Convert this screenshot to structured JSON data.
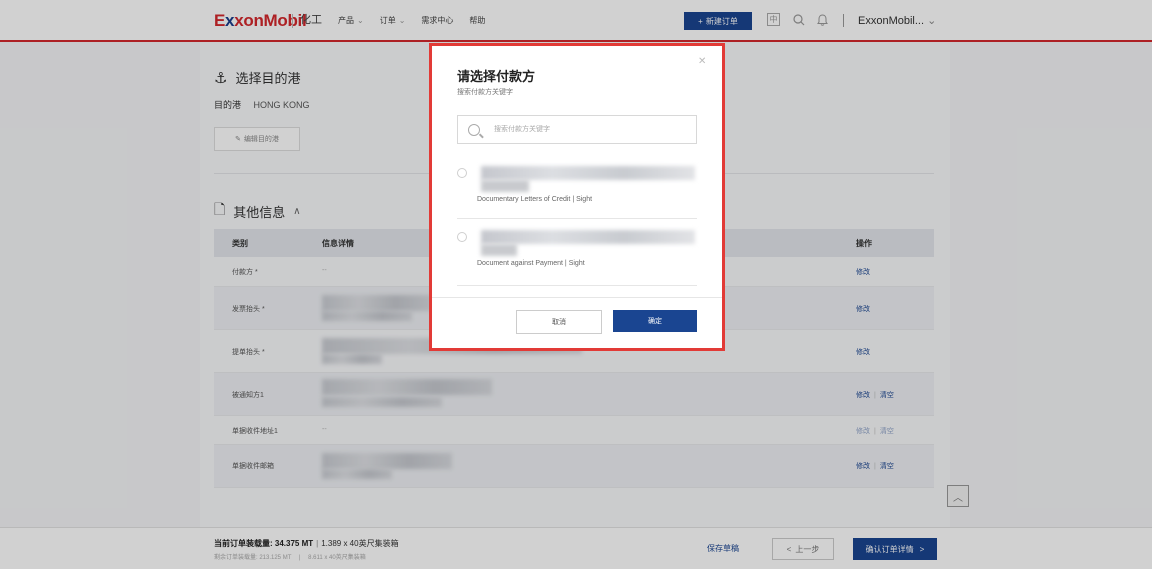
{
  "header": {
    "logo": "ExxonMobil",
    "nav": [
      "化工",
      "产品",
      "订单",
      "需求中心",
      "帮助"
    ],
    "new_order_label": "新建订单",
    "user_name": "ExxonMobil..."
  },
  "destination": {
    "title": "选择目的港",
    "port_label": "目的港",
    "port_value": "HONG KONG",
    "edit_button": "编辑目的港"
  },
  "other_info": {
    "title": "其他信息",
    "columns": {
      "category": "类别",
      "details": "信息详情",
      "action": "操作"
    },
    "rows": [
      {
        "label": "付款方 *",
        "detail": "--",
        "actions": [
          "修改"
        ]
      },
      {
        "label": "发票抬头 *",
        "detail": "",
        "actions": [
          "修改"
        ]
      },
      {
        "label": "提单抬头 *",
        "detail": "",
        "actions": [
          "修改"
        ]
      },
      {
        "label": "被通知方1",
        "detail": "",
        "actions": [
          "修改",
          "清空"
        ]
      },
      {
        "label": "单据收件地址1",
        "detail": "--",
        "actions": [
          "修改",
          "清空"
        ]
      },
      {
        "label": "单据收件邮箱",
        "detail": "",
        "actions": [
          "修改",
          "清空"
        ]
      }
    ]
  },
  "bottom": {
    "current_load": "当前订单装载量: 34.375 MT",
    "container": "1.389 x 40英尺集装箱",
    "remaining_load": "剩余订单装载量: 213.125 MT",
    "remaining_container": "8.611 x 40英尺集装箱",
    "save_draft": "保存草稿",
    "prev_step": "上一步",
    "confirm_next": "确认订单详情"
  },
  "modal": {
    "title": "请选择付款方",
    "subtitle": "搜索付款方关键字",
    "search_placeholder": "搜索付款方关键字",
    "options": [
      {
        "terms": "Documentary Letters of Credit | Sight"
      },
      {
        "terms": "Document against Payment | Sight"
      }
    ],
    "cancel_label": "取消",
    "confirm_label": "确定"
  }
}
